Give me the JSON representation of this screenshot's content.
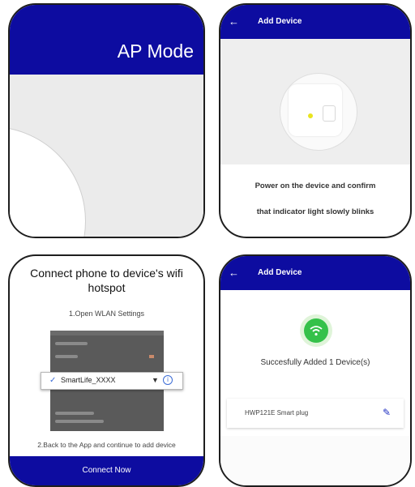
{
  "panel1": {
    "header": "AP Mode"
  },
  "panel2": {
    "back_icon": "←",
    "title": "Add Device",
    "message_line1": "Power on the device and confirm",
    "message_line2": "that indicator light slowly blinks",
    "led_color": "#e9e41f"
  },
  "panel3": {
    "title": "Connect phone to device's wifi hotspot",
    "step1": "1.Open WLAN Settings",
    "wifi_network": "SmartLife_XXXX",
    "check_icon": "✓",
    "wifi_icon": "▼",
    "info_icon": "i",
    "step2": "2.Back to the App and continue to add device",
    "button": "Connect Now"
  },
  "panel4": {
    "back_icon": "←",
    "title": "Add Device",
    "success": "Succesfully Added 1 Device(s)",
    "device_name": "HWP121E Smart plug",
    "edit_icon": "✎",
    "success_color": "#35c14a"
  },
  "colors": {
    "navy": "#0d0ca0"
  }
}
